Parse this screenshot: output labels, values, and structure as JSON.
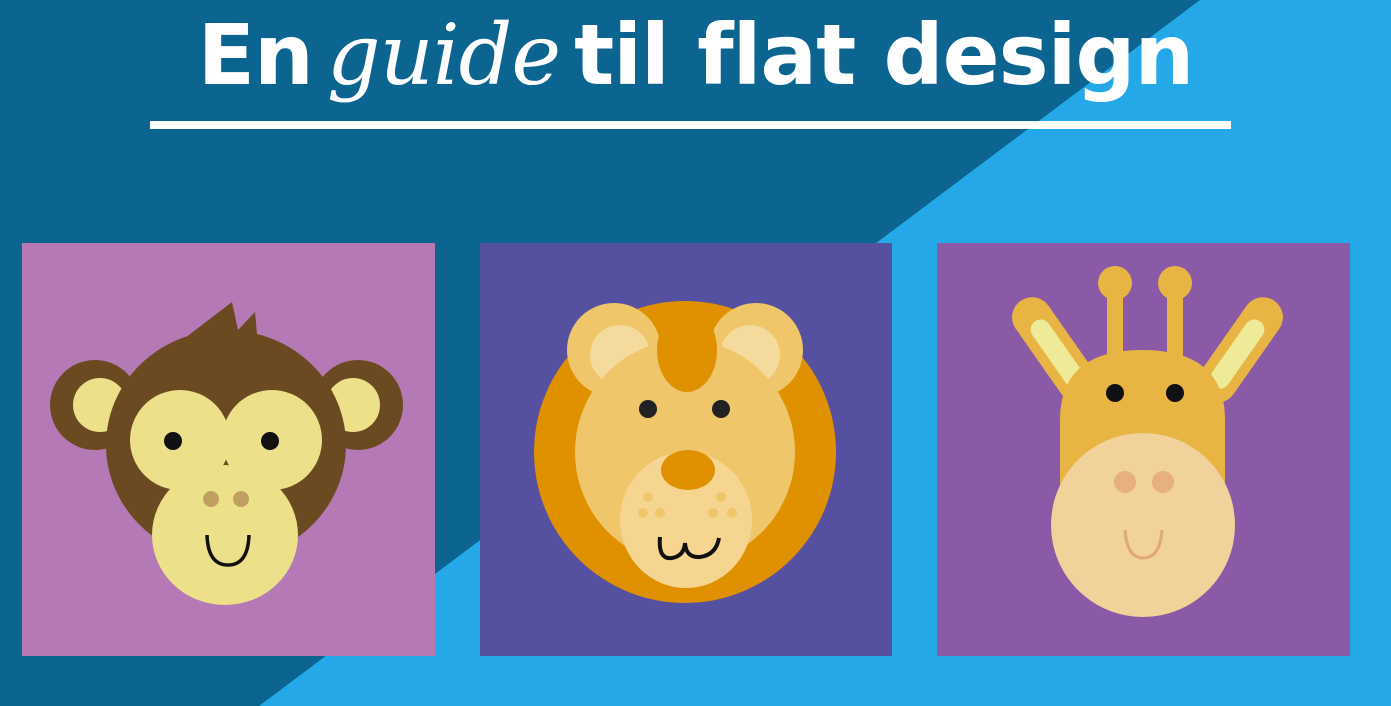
{
  "title": {
    "part1": "En",
    "emphasis": "guide",
    "part2": "til flat design"
  },
  "colors": {
    "bg_dark": "#0c6490",
    "bg_light": "#24a8e8",
    "panel_monkey": "#b579b5",
    "panel_lion": "#5550a0",
    "panel_giraffe": "#8a5aa6"
  },
  "panels": [
    {
      "animal": "monkey"
    },
    {
      "animal": "lion"
    },
    {
      "animal": "giraffe"
    }
  ]
}
